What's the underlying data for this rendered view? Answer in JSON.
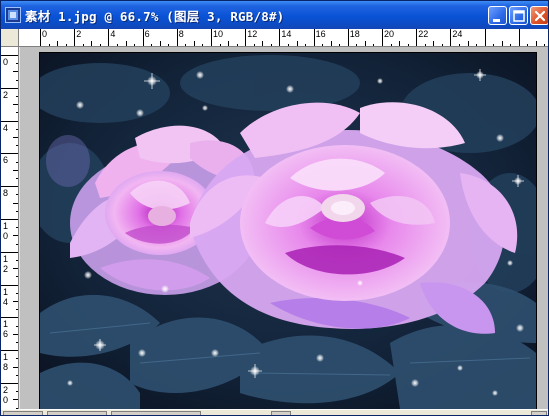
{
  "window": {
    "title": "素材 1.jpg @ 66.7% (图层 3, RGB/8#)",
    "app_icon": "photoshop-document-icon",
    "controls": {
      "minimize": "minimize-icon",
      "maximize": "maximize-icon",
      "close": "close-icon"
    }
  },
  "ruler": {
    "top_labels": [
      "0",
      "2",
      "4",
      "6",
      "8",
      "10",
      "12",
      "14",
      "16",
      "18",
      "20",
      "22",
      "24"
    ],
    "left_labels": [
      "0",
      "2",
      "4",
      "6",
      "8",
      "10",
      "12",
      "14",
      "16",
      "18",
      "20"
    ]
  },
  "document": {
    "filename": "素材 1.jpg",
    "zoom": "66.7%",
    "layer": "图层 3",
    "mode": "RGB/8#",
    "content": "photo of glowing pink-purple peony flowers with sparkles on dark blue foliage"
  },
  "colors": {
    "title_bar": "#0a53d6",
    "flower_pink": "#e89ae8",
    "flower_magenta": "#c23cc8",
    "background_dark": "#0f1c2e",
    "leaves": "#2b4a66"
  }
}
